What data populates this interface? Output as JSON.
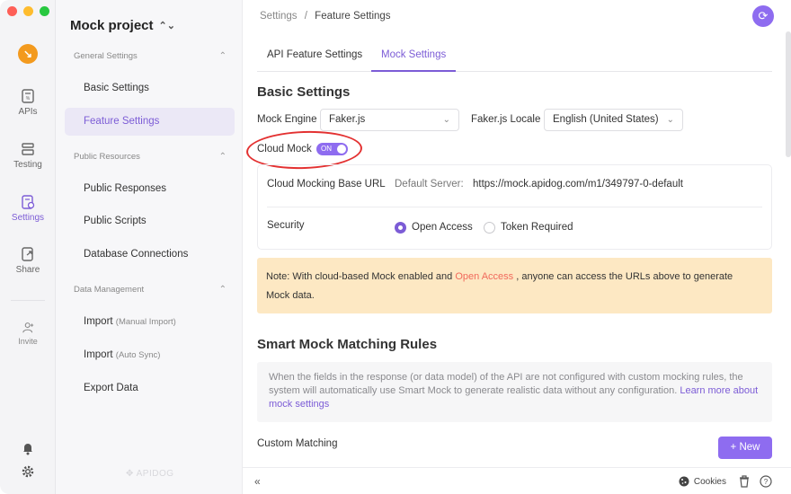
{
  "rail": {
    "items": [
      {
        "label": "APIs",
        "icon": "api-doc-icon"
      },
      {
        "label": "Testing",
        "icon": "testing-icon"
      },
      {
        "label": "Settings",
        "icon": "settings-icon",
        "active": true
      },
      {
        "label": "Share",
        "icon": "share-icon"
      },
      {
        "label": "Invite",
        "icon": "invite-user-icon"
      }
    ]
  },
  "sidebar": {
    "project_name": "Mock project",
    "groups": [
      {
        "label": "General Settings"
      },
      {
        "label": "Public Resources"
      },
      {
        "label": "Data Management"
      }
    ],
    "items": [
      {
        "label": "Basic Settings",
        "sub": ""
      },
      {
        "label": "Feature Settings",
        "sub": ""
      },
      {
        "label": "Public Responses",
        "sub": ""
      },
      {
        "label": "Public Scripts",
        "sub": ""
      },
      {
        "label": "Database Connections",
        "sub": ""
      },
      {
        "label": "Import",
        "sub": "(Manual Import)"
      },
      {
        "label": "Import",
        "sub": "(Auto Sync)"
      },
      {
        "label": "Export Data",
        "sub": ""
      }
    ],
    "watermark": "APIDOG"
  },
  "header": {
    "breadcrumb_root": "Settings",
    "breadcrumb_sep": "/",
    "breadcrumb_current": "Feature Settings"
  },
  "tabs": [
    {
      "label": "API Feature Settings"
    },
    {
      "label": "Mock Settings",
      "active": true
    }
  ],
  "basic": {
    "title": "Basic Settings",
    "engine_label": "Mock Engine",
    "engine_value": "Faker.js",
    "locale_label": "Faker.js Locale",
    "locale_value": "English (United States)",
    "cloud_label": "Cloud Mock",
    "cloud_toggle": "ON",
    "base_url_label": "Cloud Mocking Base URL",
    "server_label": "Default Server:",
    "server_url": "https://mock.apidog.com/m1/349797-0-default",
    "security_label": "Security",
    "security_options": [
      "Open Access",
      "Token Required"
    ],
    "security_selected": "Open Access"
  },
  "note": {
    "prefix": "Note: With cloud-based Mock enabled and ",
    "highlight": "Open Access",
    "suffix": " , anyone can access the URLs above to generate",
    "line2": "Mock data."
  },
  "smart": {
    "title": "Smart Mock Matching Rules",
    "desc": "When the fields in the response (or data model) of the API are not configured with custom mocking rules, the system will automatically use Smart Mock to generate realistic data without any configuration. ",
    "link": "Learn more about mock settings",
    "custom_label": "Custom Matching",
    "new_label": "+ New"
  },
  "footer": {
    "cookies_label": "Cookies"
  },
  "colors": {
    "accent": "#7c5cd6",
    "button": "#8e6cf0",
    "note_bg": "#fde8c3",
    "annotation": "#e33131"
  }
}
